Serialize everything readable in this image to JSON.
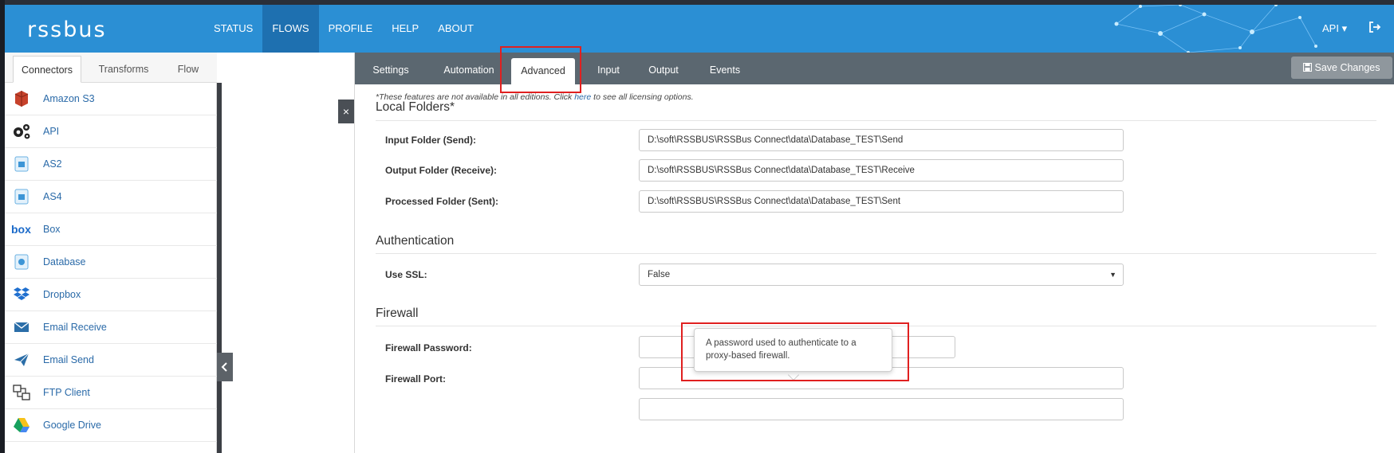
{
  "app": {
    "brand": "rssbus"
  },
  "topnav": {
    "items": [
      {
        "label": "STATUS"
      },
      {
        "label": "FLOWS",
        "active": true
      },
      {
        "label": "PROFILE"
      },
      {
        "label": "HELP"
      },
      {
        "label": "ABOUT"
      }
    ],
    "user_menu": "API ▾"
  },
  "left_panel": {
    "tabs": [
      {
        "label": "Connectors",
        "active": true
      },
      {
        "label": "Transforms"
      },
      {
        "label": "Flow"
      }
    ],
    "connectors": [
      {
        "label": "Amazon S3",
        "icon": "amazon-s3-icon"
      },
      {
        "label": "API",
        "icon": "gears-icon"
      },
      {
        "label": "AS2",
        "icon": "as2-icon"
      },
      {
        "label": "AS4",
        "icon": "as4-icon"
      },
      {
        "label": "Box",
        "icon": "box-icon"
      },
      {
        "label": "Database",
        "icon": "database-icon"
      },
      {
        "label": "Dropbox",
        "icon": "dropbox-icon"
      },
      {
        "label": "Email Receive",
        "icon": "envelope-icon"
      },
      {
        "label": "Email Send",
        "icon": "paper-plane-icon"
      },
      {
        "label": "FTP Client",
        "icon": "ftp-icon"
      },
      {
        "label": "Google Drive",
        "icon": "google-drive-icon"
      }
    ]
  },
  "main": {
    "tabs": [
      {
        "label": "Settings"
      },
      {
        "label": "Automation"
      },
      {
        "label": "Advanced",
        "active": true
      },
      {
        "label": "Input"
      },
      {
        "label": "Output"
      },
      {
        "label": "Events"
      }
    ],
    "save_label": "Save Changes",
    "note": {
      "before": "*These features are not available in all editions. Click ",
      "link": "here",
      "after": " to see all licensing options."
    },
    "local_folders": {
      "title": "Local Folders*",
      "fields": [
        {
          "label": "Input Folder (Send):",
          "value": "D:\\soft\\RSSBUS\\RSSBus Connect\\data\\Database_TEST\\Send"
        },
        {
          "label": "Output Folder (Receive):",
          "value": "D:\\soft\\RSSBUS\\RSSBus Connect\\data\\Database_TEST\\Receive"
        },
        {
          "label": "Processed Folder (Sent):",
          "value": "D:\\soft\\RSSBUS\\RSSBus Connect\\data\\Database_TEST\\Sent"
        }
      ]
    },
    "authentication": {
      "title": "Authentication",
      "use_ssl_label": "Use SSL:",
      "use_ssl_value": "False"
    },
    "firewall": {
      "title": "Firewall",
      "password_label": "Firewall Password:",
      "password_value": "",
      "port_label": "Firewall Port:",
      "port_value": "",
      "tooltip": "A password used to authenticate to a proxy-based firewall."
    }
  },
  "colors": {
    "topbar": "#2b8fd4",
    "active_nav": "#1e70b0",
    "tabbar": "#5b6770",
    "link": "#2a6aa8",
    "highlight": "#e02020"
  }
}
